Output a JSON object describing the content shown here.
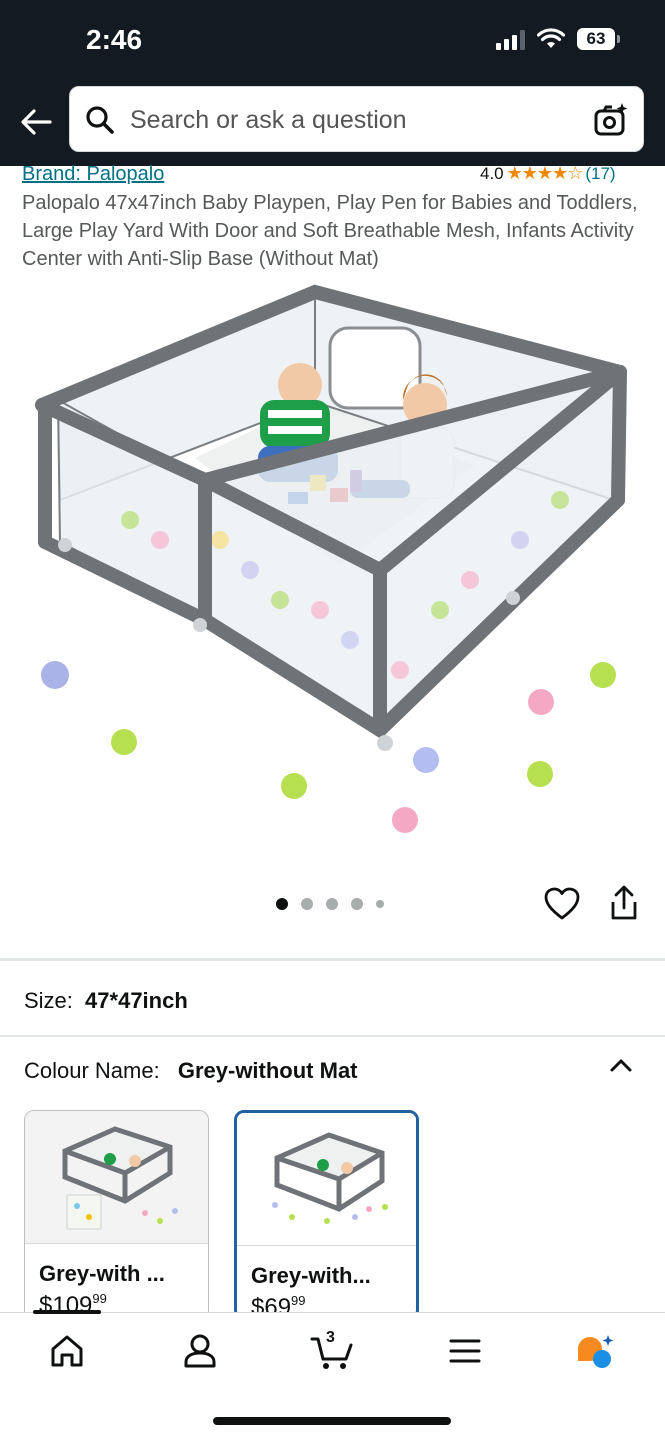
{
  "status_bar": {
    "time": "2:46",
    "battery": "63"
  },
  "search": {
    "placeholder": "Search or ask a question"
  },
  "product": {
    "brand": "Brand: Palopalo",
    "rating_value": "4.0",
    "stars": "★★★★☆",
    "rating_count": "(17)",
    "title": "Palopalo 47x47inch Baby Playpen, Play Pen for Babies and Toddlers, Large Play Yard With Door and Soft Breathable Mesh, Infants Activity Center with Anti-Slip Base (Without Mat)",
    "image_count": 5,
    "active_image_index": 0
  },
  "size": {
    "label": "Size:",
    "value": "47*47inch"
  },
  "colour": {
    "label": "Colour Name:",
    "value": "Grey-without Mat",
    "options": [
      {
        "name": "Grey-with ...",
        "price_dollars": "$109",
        "price_cents": "99",
        "selected": false
      },
      {
        "name": "Grey-with...",
        "price_dollars": "$69",
        "price_cents": "99",
        "selected": true
      }
    ]
  },
  "bottom_nav": {
    "items": [
      {
        "icon": "home-icon"
      },
      {
        "icon": "account-icon"
      },
      {
        "icon": "cart-icon",
        "badge": "3"
      },
      {
        "icon": "menu-icon"
      },
      {
        "icon": "rufus-assistant-icon"
      }
    ]
  },
  "colors": {
    "header_bg": "#131a22",
    "link": "#007185",
    "star": "#f08804",
    "selected_border": "#2162a1",
    "rufus_orange": "#f6891f",
    "rufus_blue": "#1a8fe3"
  }
}
